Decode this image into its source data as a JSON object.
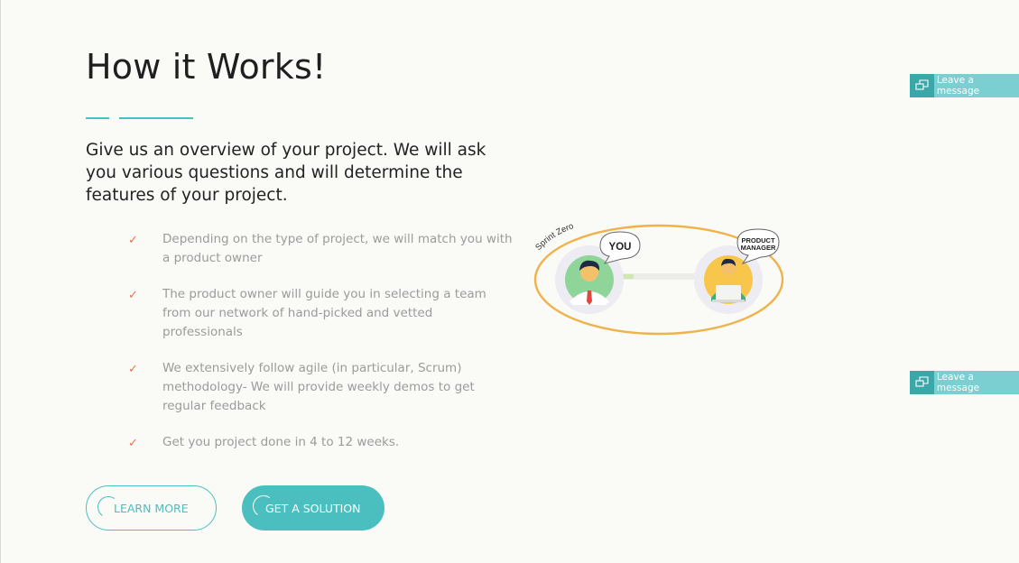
{
  "section": {
    "title": "How it Works!",
    "intro": "Give us an overview of your project. We will ask you various questions and will determine the features of your project.",
    "features": [
      "Depending on the type of project, we will match you with a product owner",
      "The product owner will guide you in selecting a team from our network of hand-picked and vetted professionals",
      "We extensively follow agile (in particular, Scrum) methodology- We will provide weekly demos to get regular feedback",
      "Get you project done in 4 to 12 weeks."
    ],
    "check_glyph": "✓"
  },
  "buttons": {
    "learn_more": "LEARN MORE",
    "get_solution": "GET A SOLUTION"
  },
  "illustration": {
    "label": "Sprint Zero",
    "bubble_you": "YOU",
    "bubble_pm_line1": "PRODUCT",
    "bubble_pm_line2": "MANAGER"
  },
  "chat_widgets": [
    {
      "label": "Leave a message"
    },
    {
      "label": "Leave a message"
    }
  ],
  "colors": {
    "accent": "#4bbfc0",
    "check": "#e8734f",
    "ring": "#f0b24a",
    "widget": "#7bcfd1"
  }
}
